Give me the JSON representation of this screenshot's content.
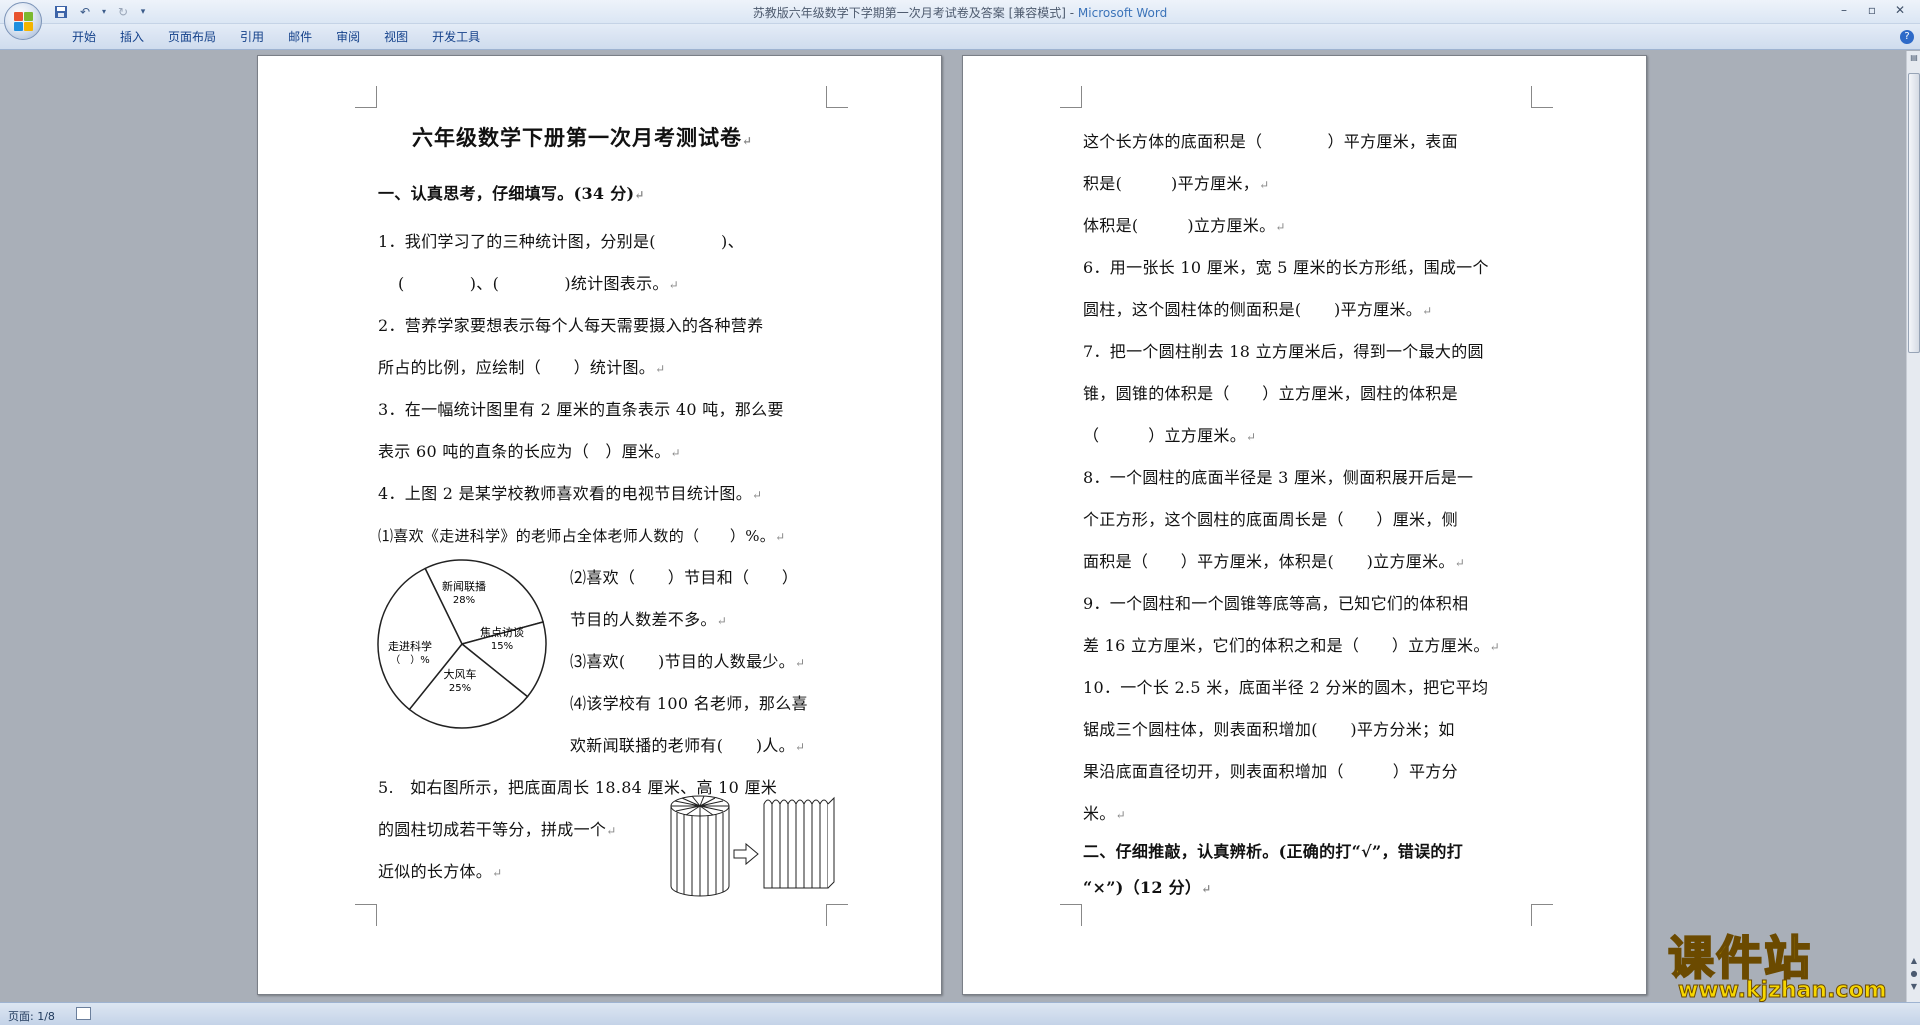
{
  "window": {
    "title_doc": "苏教版六年级数学下学期第一次月考试卷及答案 [兼容模式] - ",
    "title_app": "Microsoft Word"
  },
  "ribbon": {
    "tabs": [
      "开始",
      "插入",
      "页面布局",
      "引用",
      "邮件",
      "审阅",
      "视图",
      "开发工具"
    ]
  },
  "page1": {
    "title": "六年级数学下册第一次月考测试卷",
    "section1": "一、认真思考，仔细填写。(34 分)",
    "q1a": "1．我们学习了的三种统计图，分别是(　　　　)、",
    "q1b": "(　　　　)、(　　　　)统计图表示。",
    "q2a": "2．营养学家要想表示每个人每天需要摄入的各种营养",
    "q2b": "所占的比例，应绘制（　　）统计图。",
    "q3a": "3．在一幅统计图里有 2 厘米的直条表示 40 吨，那么要",
    "q3b": "表示 60 吨的直条的长应为（　）厘米。",
    "q4": "4．上图 2 是某学校教师喜欢看的电视节目统计图。",
    "q4_1": "⑴喜欢《走进科学》的老师占全体老师人数的（　　）%。",
    "q4_2a": "⑵喜欢（　　）节目和（　　）",
    "q4_2b": "节目的人数差不多。",
    "q4_3": "⑶喜欢(　　)节目的人数最少。",
    "q4_4a": "⑷该学校有 100 名老师，那么喜",
    "q4_4b": "欢新闻联播的老师有(　　)人。",
    "q5a": "5.　如右图所示，把底面周长 18.84 厘米、高 10 厘米",
    "q5b": "的圆柱切成若干等分，拼成一个",
    "q5c": "近似的长方体。"
  },
  "pie": {
    "slices": [
      {
        "name": "新闻联播",
        "label": "28%",
        "percent": 28
      },
      {
        "name": "焦点访谈",
        "label": "15%",
        "percent": 15
      },
      {
        "name": "大风车",
        "label": "25%",
        "percent": 25
      },
      {
        "name": "走进科学",
        "label": "（　）%",
        "percent": 32
      }
    ]
  },
  "page2": {
    "l1": "这个长方体的底面积是（　　　　）平方厘米，表面",
    "l2": "积是(　　　)平方厘米，",
    "l3": "体积是(　　　)立方厘米。",
    "q6a": "6．用一张长 10 厘米，宽 5 厘米的长方形纸，围成一个",
    "q6b": "圆柱，这个圆柱体的侧面积是(　　)平方厘米。",
    "q7a": "7．把一个圆柱削去 18 立方厘米后，得到一个最大的圆",
    "q7b": "锥，圆锥的体积是（　　）立方厘米，圆柱的体积是",
    "q7c": "（　　　）立方厘米。",
    "q8a": "8．一个圆柱的底面半径是 3 厘米，侧面积展开后是一",
    "q8b": "个正方形，这个圆柱的底面周长是（　　）厘米，侧",
    "q8c": "面积是（　　）平方厘米，体积是(　　)立方厘米。",
    "q9a": "9．一个圆柱和一个圆锥等底等高，已知它们的体积相",
    "q9b": "差 16 立方厘米，它们的体积之和是（　　）立方厘米。",
    "q10a": "10．一个长 2.5 米，底面半径 2 分米的圆木，把它平均",
    "q10b": "锯成三个圆柱体，则表面积增加(　　)平方分米；如",
    "q10c": "果沿底面直径切开，则表面积增加（　　　）平方分",
    "q10d": "米。",
    "section2a": "二、仔细推敲，认真辨析。(正确的打“√”，错误的打",
    "section2b": "“×”)（12 分）"
  },
  "status": {
    "page": "页面: 1/8"
  },
  "watermark": {
    "main": "课件站",
    "url": "www.kjzhan.com"
  },
  "colors": {
    "workspace": "#a9afb8",
    "ribbon_text": "#15428b",
    "brand": "#3b73b9"
  }
}
